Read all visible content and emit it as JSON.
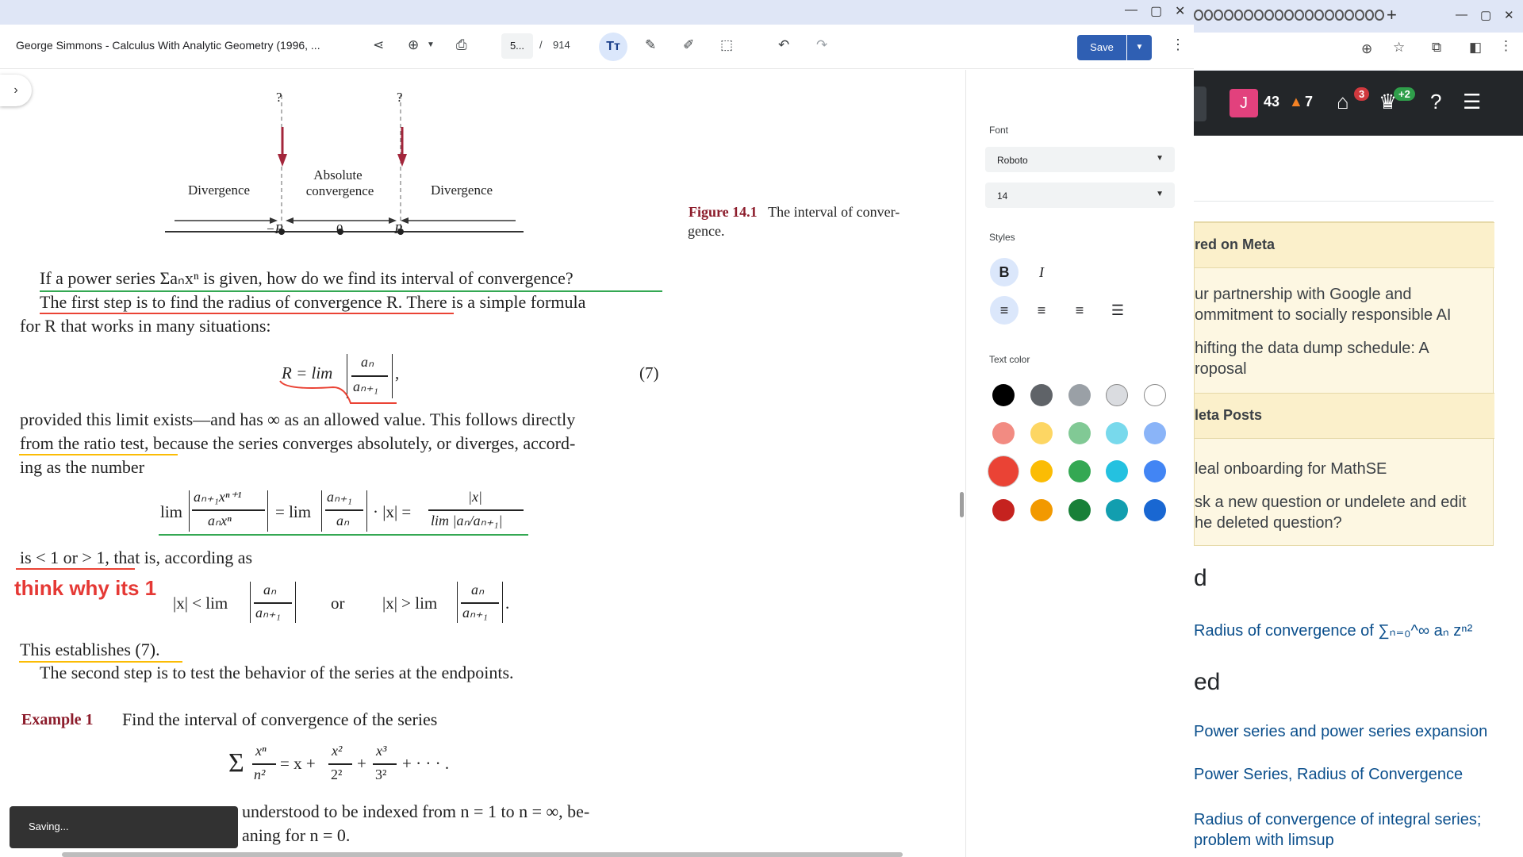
{
  "viewer": {
    "doc_title": "George Simmons - Calculus With Analytic Geometry (1996, ...",
    "page_current": "5...",
    "page_separator": "/",
    "page_total": "914",
    "text_tool_label": "Tт",
    "save_label": "Save",
    "toast": "Saving..."
  },
  "page": {
    "figure": {
      "q_left": "?",
      "q_right": "?",
      "divergence_left": "Divergence",
      "absolute": "Absolute",
      "convergence": "convergence",
      "divergence_right": "Divergence",
      "tick_neg_r": "−R",
      "tick_zero": "0",
      "tick_r": "R",
      "caption_label": "Figure 14.1",
      "caption_line1": "The interval of conver-",
      "caption_line2": "gence."
    },
    "para1_line1": "If a power series Σaₙxⁿ is given, how do we find its interval of convergence?",
    "para1_line2_a": "The first step is to find the radius of convergence R.",
    "para1_line2_b": "There is a simple formula",
    "para1_line3": "for R that works in many situations:",
    "eq7_left": "R = lim",
    "eq7_num": "aₙ",
    "eq7_den": "aₙ₊₁",
    "eq7_comma": ",",
    "eq7_number": "(7)",
    "para2_line1": "provided this limit exists—and has ∞ as an allowed value. This follows directly",
    "para2_line2_a": "from the ratio test,",
    "para2_line2_b": "because the series converges absolutely, or diverges, accord-",
    "para2_line3": "ing as the number",
    "ratio_lim1": "lim",
    "ratio_num1": "aₙ₊₁xⁿ⁺¹",
    "ratio_den1": "aₙxⁿ",
    "ratio_eq1": "= lim",
    "ratio_num2": "aₙ₊₁",
    "ratio_den2": "aₙ",
    "ratio_dot": "· |x| =",
    "ratio_num3": "|x|",
    "ratio_den3": "lim |aₙ/aₙ₊₁|",
    "para3_line1": "is < 1 or > 1, that is, according as",
    "handwritten_note": "think why its 1",
    "cond_left": "|x| < lim",
    "cond_or": "or",
    "cond_right": "|x| > lim",
    "cond_num": "aₙ",
    "cond_den": "aₙ₊₁",
    "cond_period": ".",
    "para4_line1": "This establishes (7).",
    "para4_line2": "The second step is to test the behavior of the series at the endpoints.",
    "example_label": "Example 1",
    "example_text": "Find the interval of convergence of the series",
    "series_sum": "Σ",
    "series_n1": "xⁿ",
    "series_d1": "n²",
    "series_eq": "= x +",
    "series_n2": "x²",
    "series_d2": "2²",
    "series_plus": "+",
    "series_n3": "x³",
    "series_d3": "3²",
    "series_tail": "+ · · · .",
    "para5_line1": "understood to be indexed from n = 1 to n = ∞, be-",
    "para5_line2": "aning for n = 0."
  },
  "format_panel": {
    "font_label": "Font",
    "font_value": "Roboto",
    "size_value": "14",
    "styles_label": "Styles",
    "bold": "B",
    "italic": "I",
    "text_color_label": "Text color",
    "colors": [
      [
        "#000000",
        "#5f6368",
        "#9aa0a6",
        "#dadce0",
        "#ffffff"
      ],
      [
        "#f28b82",
        "#fdd663",
        "#81c995",
        "#78d9ec",
        "#8ab4f8"
      ],
      [
        "#ea4335",
        "#fbbc04",
        "#34a853",
        "#24c1e0",
        "#4285f4"
      ],
      [
        "#c5221f",
        "#f29900",
        "#188038",
        "#129eaf",
        "#1967d2"
      ]
    ]
  },
  "background": {
    "rep_count": "43",
    "warn_count": "7",
    "inbox_badge": "3",
    "achv_badge": "+2",
    "avatar_letter": "J",
    "meta_head1": "red on Meta",
    "meta_item1_l1": "ur partnership with Google and",
    "meta_item1_l2": "ommitment to socially responsible AI",
    "meta_item2_l1": "hifting the data dump schedule: A",
    "meta_item2_l2": "roposal",
    "meta_head2": "leta Posts",
    "meta_item3": "leal onboarding for MathSE",
    "meta_item4_l1": "sk a new question or undelete and edit",
    "meta_item4_l2": "he deleted question?",
    "section1": "d",
    "linked1": "Radius of convergence of ∑ₙ₌₀^∞ aₙ zⁿ²",
    "section2": "ed",
    "related1": "Power series and power series expansion",
    "related2": "Power Series, Radius of Convergence",
    "related3_l1": "Radius of convergence of integral series;",
    "related3_l2": "problem with limsup"
  }
}
